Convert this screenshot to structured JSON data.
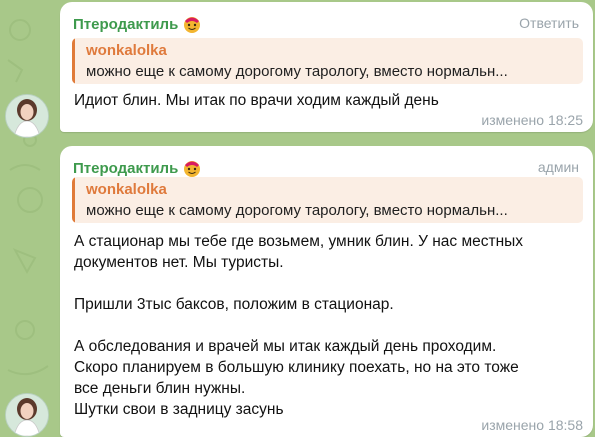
{
  "messages": [
    {
      "sender": "Птеродактиль",
      "action": "Ответить",
      "reply": {
        "author": "wonkalolka",
        "text": "можно еще к самому дорогому тарологу, вместо нормальн..."
      },
      "body": [
        "Идиот блин. Мы итак по врачи ходим каждый день"
      ],
      "edited": "изменено",
      "time": "18:25"
    },
    {
      "sender": "Птеродактиль",
      "role": "админ",
      "reply": {
        "author": "wonkalolka",
        "text": "можно еще к самому дорогому тарологу, вместо нормальн..."
      },
      "body": [
        "А стационар мы тебе где возьмем, умник блин. У нас местных",
        "документов нет. Мы туристы.",
        "",
        "Пришли 3тыс баксов, положим в стационар.",
        "",
        "А обследования и врачей мы итак каждый день проходим.",
        "Скоро планируем в большую клинику поехать, но на это тоже",
        "все деньги блин нужны.",
        "Шутки свои в задницу засунь"
      ],
      "edited": "изменено",
      "time": "18:58"
    }
  ],
  "colors": {
    "wallpaper": "#a9c98a",
    "sender": "#3e9a4d",
    "quote_accent": "#e07b39",
    "quote_bg": "#fbeee4",
    "meta": "#9aa4ab"
  }
}
